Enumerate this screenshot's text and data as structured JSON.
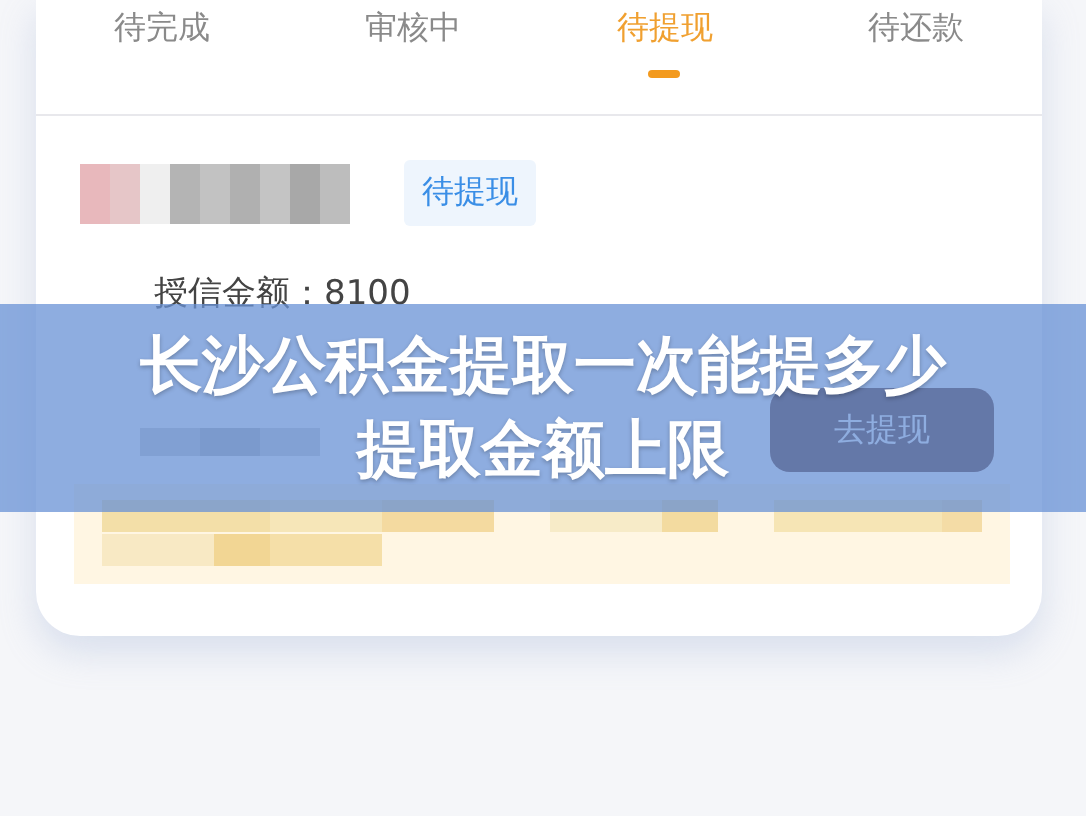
{
  "tabs": [
    {
      "label": "待完成",
      "selected": false
    },
    {
      "label": "审核中",
      "selected": false
    },
    {
      "label": "待提现",
      "selected": true
    },
    {
      "label": "待还款",
      "selected": false
    }
  ],
  "order": {
    "status_tag": "待提现",
    "credit_label": "授信金额：",
    "credit_value": "8100",
    "action_button": "去提现"
  },
  "banner": {
    "lines": [
      "长沙公积金提取一次能提多少",
      "提取金额上限"
    ]
  }
}
